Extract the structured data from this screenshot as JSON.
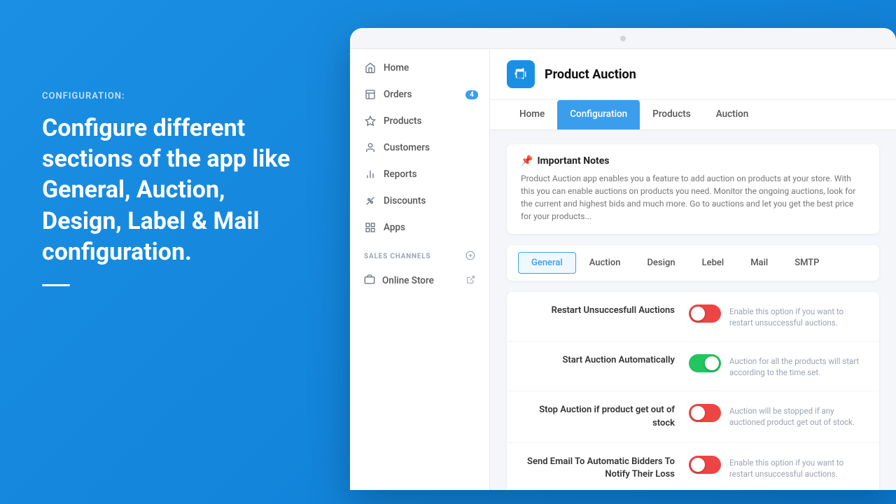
{
  "left_panel": {
    "config_label": "CONFIGURATION:",
    "config_title": "Configure different sections of the app like General, Auction, Design, Label & Mail configuration."
  },
  "app": {
    "title": "Product Auction",
    "icon_text": "🔨"
  },
  "nav_tabs": [
    {
      "id": "home",
      "label": "Home",
      "active": false
    },
    {
      "id": "configuration",
      "label": "Configuration",
      "active": true
    },
    {
      "id": "products",
      "label": "Products",
      "active": false
    },
    {
      "id": "auction",
      "label": "Auction",
      "active": false
    }
  ],
  "sidebar": {
    "items": [
      {
        "id": "home",
        "label": "Home",
        "icon": "home"
      },
      {
        "id": "orders",
        "label": "Orders",
        "icon": "orders",
        "badge": "4"
      },
      {
        "id": "products",
        "label": "Products",
        "icon": "products"
      },
      {
        "id": "customers",
        "label": "Customers",
        "icon": "customers"
      },
      {
        "id": "reports",
        "label": "Reports",
        "icon": "reports"
      },
      {
        "id": "discounts",
        "label": "Discounts",
        "icon": "discounts"
      },
      {
        "id": "apps",
        "label": "Apps",
        "icon": "apps"
      }
    ],
    "sales_channels_label": "SALES CHANNELS",
    "channels": [
      {
        "id": "online-store",
        "label": "Online Store",
        "icon": "store"
      }
    ]
  },
  "notes": {
    "title": "Important Notes",
    "icon": "📌",
    "text": "Product Auction app enables you a feature to add auction on products at your store. With this you can enable auctions on products you need. Monitor the ongoing auctions, look for the current and highest bids and much more. Go to auctions and let you get the best price for your products..."
  },
  "settings_tabs": [
    {
      "id": "general",
      "label": "General",
      "active": true
    },
    {
      "id": "auction",
      "label": "Auction",
      "active": false
    },
    {
      "id": "design",
      "label": "Design",
      "active": false
    },
    {
      "id": "lebel",
      "label": "Lebel",
      "active": false
    },
    {
      "id": "mail",
      "label": "Mail",
      "active": false
    },
    {
      "id": "smtp",
      "label": "SMTP",
      "active": false
    }
  ],
  "settings": [
    {
      "id": "restart-unsuccessful",
      "label": "Restart Unsuccesfull Auctions",
      "description": "Enable this option if you want to restart unsuccessful auctions.",
      "toggle": "off"
    },
    {
      "id": "start-automatically",
      "label": "Start Auction Automatically",
      "description": "Auction for all the products will start according to the time set.",
      "toggle": "on"
    },
    {
      "id": "stop-out-of-stock",
      "label": "Stop Auction if product get out of stock",
      "description": "Auction will be stopped if any auctioned product get out of stock.",
      "toggle": "off"
    },
    {
      "id": "send-email-bidders",
      "label": "Send Email To Automatic Bidders To Notify Their Loss",
      "description": "Enable this option if you want to restart unsuccessful auctions.",
      "toggle": "off"
    }
  ]
}
